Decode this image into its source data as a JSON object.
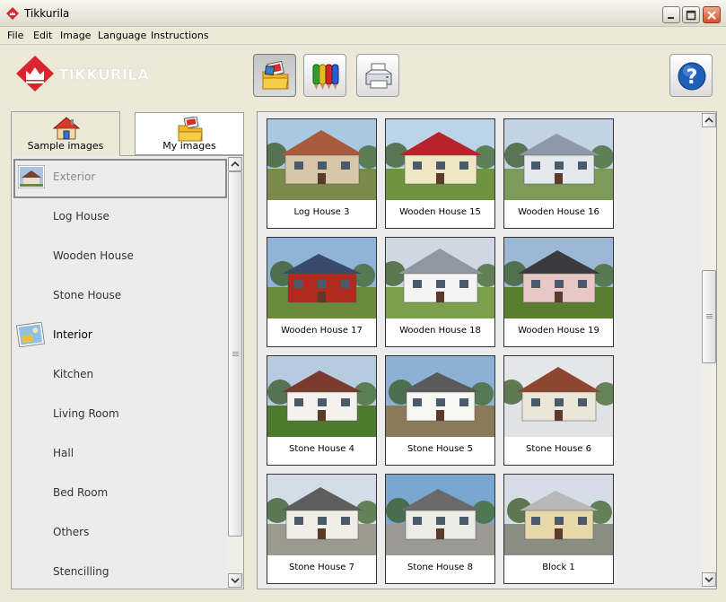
{
  "window": {
    "title": "Tikkurila"
  },
  "menu": [
    "File",
    "Edit",
    "Image",
    "Language",
    "Instructions"
  ],
  "logo": {
    "text": "TIKKURILA"
  },
  "toolbar": {
    "open_images": "open-images",
    "colors": "color-pencils",
    "print": "print",
    "help": "help"
  },
  "tabs": [
    {
      "label": "Sample images",
      "icon": "house-icon",
      "active": true
    },
    {
      "label": "My images",
      "icon": "folder-image-icon",
      "active": false
    }
  ],
  "categories": [
    {
      "label": "Exterior",
      "header": true,
      "selected": true
    },
    {
      "label": "Log House"
    },
    {
      "label": "Wooden House"
    },
    {
      "label": "Stone House"
    },
    {
      "label": "Interior",
      "header": true
    },
    {
      "label": "Kitchen"
    },
    {
      "label": "Living Room"
    },
    {
      "label": "Hall"
    },
    {
      "label": "Bed Room"
    },
    {
      "label": "Others"
    },
    {
      "label": "Stencilling"
    }
  ],
  "images": [
    {
      "label": "Log House 3",
      "sky": "#a9c8e2",
      "wall": "#d9c6a8",
      "roof": "#a85a3c",
      "ground": "#7a8a4a"
    },
    {
      "label": "Wooden House 15",
      "sky": "#bcd4ea",
      "wall": "#efe6c4",
      "roof": "#b8222a",
      "ground": "#6e9440"
    },
    {
      "label": "Wooden House 16",
      "sky": "#c3d3e4",
      "wall": "#e4e7ec",
      "roof": "#8e99a7",
      "ground": "#7e9a5a"
    },
    {
      "label": "Wooden House 17",
      "sky": "#8fb4d8",
      "wall": "#b02a1e",
      "roof": "#3a4a6a",
      "ground": "#6c8a3c"
    },
    {
      "label": "Wooden House 18",
      "sky": "#cfd8e2",
      "wall": "#f4f4f4",
      "roof": "#8f97a0",
      "ground": "#7aa04c"
    },
    {
      "label": "Wooden House 19",
      "sky": "#9db8d4",
      "wall": "#e8c8c4",
      "roof": "#3a3a40",
      "ground": "#5a7e30"
    },
    {
      "label": "Stone House 4",
      "sky": "#b6cbe0",
      "wall": "#f4f2ee",
      "roof": "#7a3a2e",
      "ground": "#4e7a2e"
    },
    {
      "label": "Stone House 5",
      "sky": "#8db0d6",
      "wall": "#f6f6f2",
      "roof": "#5a5a5a",
      "ground": "#8a7a5a"
    },
    {
      "label": "Stone House 6",
      "sky": "#e4e6ea",
      "wall": "#ece6d8",
      "roof": "#8e4630",
      "ground": "#dfe3e6"
    },
    {
      "label": "Stone House 7",
      "sky": "#d2dde8",
      "wall": "#f0eee6",
      "roof": "#5e5e5e",
      "ground": "#9a9a8e"
    },
    {
      "label": "Stone House 8",
      "sky": "#7aa6d2",
      "wall": "#ecece6",
      "roof": "#6a6a6a",
      "ground": "#9a9a92"
    },
    {
      "label": "Block 1",
      "sky": "#d6dde6",
      "wall": "#e6d8a8",
      "roof": "#b8b8b8",
      "ground": "#8a8e82"
    }
  ]
}
